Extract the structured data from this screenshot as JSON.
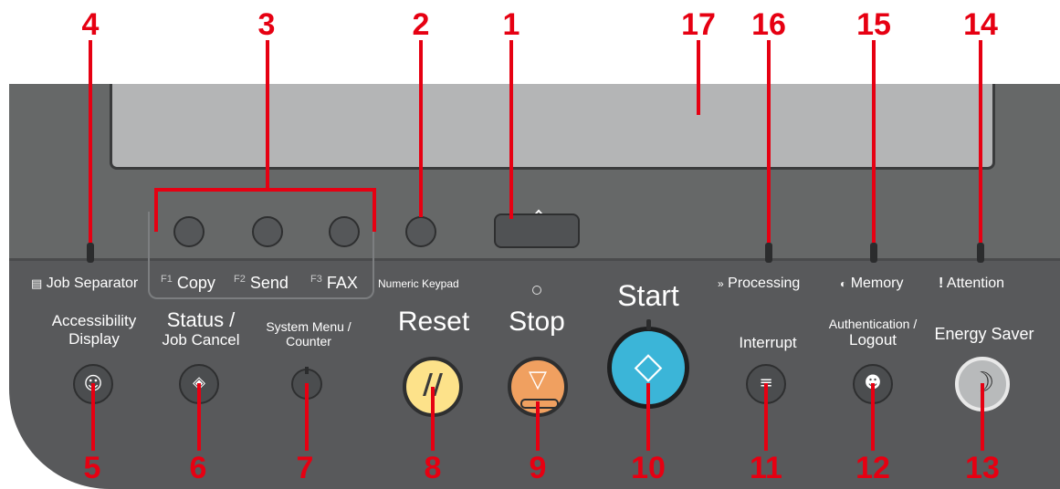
{
  "callouts": {
    "n1": "1",
    "n2": "2",
    "n3": "3",
    "n4": "4",
    "n5": "5",
    "n6": "6",
    "n7": "7",
    "n8": "8",
    "n9": "9",
    "n10": "10",
    "n11": "11",
    "n12": "12",
    "n13": "13",
    "n14": "14",
    "n15": "15",
    "n16": "16",
    "n17": "17"
  },
  "panel": {
    "job_separator": "Job Separator",
    "f1": "F1",
    "copy": "Copy",
    "f2": "F2",
    "send": "Send",
    "f3": "F3",
    "fax": "FAX",
    "numeric_keypad": "Numeric Keypad",
    "processing": "Processing",
    "memory": "Memory",
    "attention": "Attention",
    "accessibility_line1": "Accessibility",
    "accessibility_line2": "Display",
    "status_line1": "Status /",
    "status_line2": "Job Cancel",
    "sysmenu_line1": "System Menu /",
    "sysmenu_line2": "Counter",
    "reset": "Reset",
    "stop": "Stop",
    "start": "Start",
    "interrupt": "Interrupt",
    "auth_line1": "Authentication /",
    "auth_line2": "Logout",
    "energy_saver": "Energy Saver"
  },
  "icons": {
    "home": "home-icon",
    "accessibility": "accessibility-icon",
    "status": "status-icon",
    "reset": "reset-icon",
    "stop": "stop-icon",
    "start": "start-icon",
    "interrupt": "interrupt-icon",
    "auth": "authentication-icon",
    "energy": "energy-saver-icon"
  },
  "colors": {
    "callout": "#e60012",
    "panel": "#666868",
    "display": "#b4b5b6",
    "reset_button": "#fde28a",
    "stop_button": "#f0a060",
    "start_button": "#3bb5d8"
  }
}
